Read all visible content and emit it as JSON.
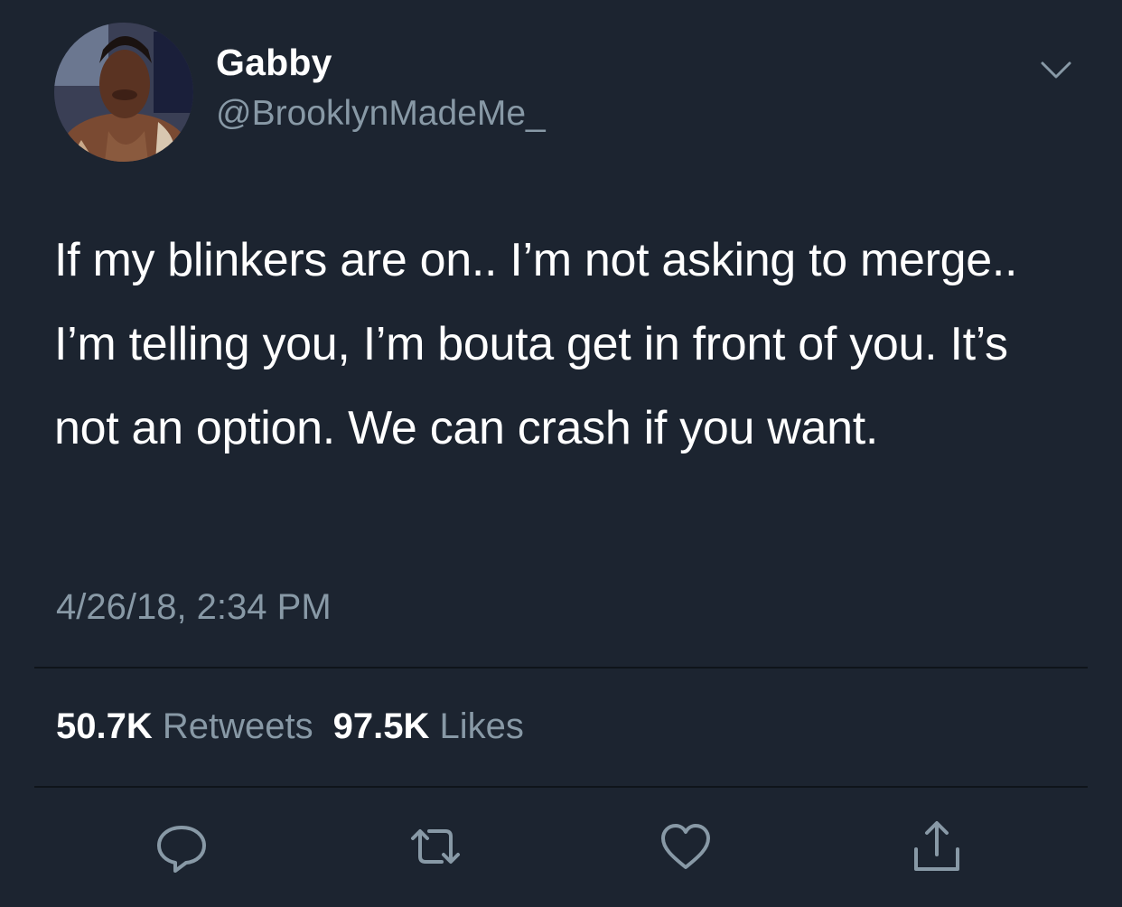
{
  "user": {
    "display_name": "Gabby",
    "handle": "@BrooklynMadeMe_",
    "avatar_icon": "profile-photo"
  },
  "tweet": {
    "text": "If my blinkers are on.. I’m not asking to merge.. I’m telling you, I’m bouta get in front of you. It’s not an option. We can crash if you want.",
    "timestamp": "4/26/18, 2:34 PM"
  },
  "stats": {
    "retweets_count": "50.7K",
    "retweets_label": "Retweets",
    "likes_count": "97.5K",
    "likes_label": "Likes"
  },
  "actions": {
    "reply_icon": "reply-icon",
    "retweet_icon": "retweet-icon",
    "like_icon": "heart-icon",
    "share_icon": "share-icon"
  },
  "colors": {
    "background": "#1c2430",
    "text_primary": "#ffffff",
    "text_secondary": "#8899a6",
    "divider": "#0f141a"
  }
}
